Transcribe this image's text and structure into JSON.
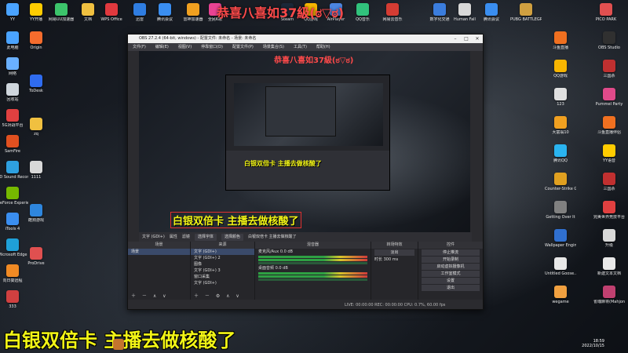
{
  "banner": {
    "top_text": "恭喜八喜如37級(ಠ▽ಠ)"
  },
  "caption": {
    "main": "白银双倍卡 主播去做核酸了"
  },
  "clock": {
    "time": "18:59",
    "date": "2022/10/15"
  },
  "desktop_icons_top": [
    {
      "label": "YY",
      "color": "#4aa3ff"
    },
    {
      "label": "YY开播",
      "color": "#ffcc00"
    },
    {
      "label": "网易UU加速器",
      "color": "#3cc46b"
    },
    {
      "label": "文档",
      "color": "#f0c040"
    },
    {
      "label": "WPS Office",
      "color": "#e0393e"
    },
    {
      "label": "迅雷",
      "color": "#2f7de1"
    },
    {
      "label": "腾讯会议",
      "color": "#3a8ef0"
    },
    {
      "label": "雷神加速器",
      "color": "#f0a020"
    },
    {
      "label": "全民K歌",
      "color": "#e84393"
    },
    {
      "label": "Steam",
      "color": "#1b2838"
    },
    {
      "label": "QQ游戏",
      "color": "#f7b500"
    },
    {
      "label": "AirPlayer",
      "color": "#4c86e0"
    },
    {
      "label": "QQ音乐",
      "color": "#31c27c"
    },
    {
      "label": "网易云音乐",
      "color": "#d43c33"
    },
    {
      "label": "数字化交通",
      "color": "#3b7ddd"
    },
    {
      "label": "Human Fall",
      "color": "#d8d8d8"
    },
    {
      "label": "腾讯会议",
      "color": "#3a8ef0"
    },
    {
      "label": "PUBG BATTLEGR...",
      "color": "#d0a040"
    },
    {
      "label": "PICO PARK",
      "color": "#e05050"
    }
  ],
  "desktop_icons_left": [
    {
      "label": "此电脑",
      "color": "#4aa3ff"
    },
    {
      "label": "网络",
      "color": "#6ab0ff"
    },
    {
      "label": "回收站",
      "color": "#cfd6dd"
    },
    {
      "label": "5G对战平台",
      "color": "#e04040"
    },
    {
      "label": "SamFire",
      "color": "#e05020"
    },
    {
      "label": "AD Sound Recorder",
      "color": "#2ea0e0"
    },
    {
      "label": "GeForce Experience",
      "color": "#76b900"
    },
    {
      "label": "iTools 4",
      "color": "#3a8ef0"
    },
    {
      "label": "Microsoft Edge",
      "color": "#1fa0d8"
    },
    {
      "label": "向日葵远程",
      "color": "#f08a24"
    },
    {
      "label": "333",
      "color": "#d04040"
    }
  ],
  "desktop_icons_left2": [
    {
      "label": "Origin",
      "color": "#f56c2d"
    },
    {
      "label": "ToDesk",
      "color": "#2f6cf0"
    },
    {
      "label": "zq",
      "color": "#f0c040"
    },
    {
      "label": "1111",
      "color": "#d8d8d8"
    },
    {
      "label": "酷狗游戏",
      "color": "#2e86de"
    },
    {
      "label": "ProDrive",
      "color": "#e05050"
    }
  ],
  "desktop_icons_right": [
    {
      "label": "斗鱼直播",
      "color": "#f07020"
    },
    {
      "label": "QQ游戏",
      "color": "#f7b500"
    },
    {
      "label": "123",
      "color": "#e0e0e0"
    },
    {
      "label": "大富翁10",
      "color": "#f0a020"
    },
    {
      "label": "腾讯QQ",
      "color": "#2ab4f0"
    },
    {
      "label": "Counter-Strike Global Off...",
      "color": "#e0a020"
    },
    {
      "label": "Getting Over It",
      "color": "#808080"
    },
    {
      "label": "Wallpaper Engine",
      "color": "#3070d0"
    },
    {
      "label": "Untitled Goose...",
      "color": "#e8e8e8"
    },
    {
      "label": "wegame",
      "color": "#f0a040"
    }
  ],
  "desktop_icons_right2": [
    {
      "label": "OBS Studio",
      "color": "#303030"
    },
    {
      "label": "三国杀",
      "color": "#c03030"
    },
    {
      "label": "Pummel Party",
      "color": "#e04a8a"
    },
    {
      "label": "斗鱼直播伴侣",
      "color": "#f07020"
    },
    {
      "label": "YY语音",
      "color": "#ffcc00"
    },
    {
      "label": "三国杀",
      "color": "#c03030"
    },
    {
      "label": "完美世界竞技平台",
      "color": "#e04040"
    },
    {
      "label": "升级",
      "color": "#d8d8d8"
    },
    {
      "label": "新建文本文档",
      "color": "#e8e8e8"
    },
    {
      "label": "雀魂麻将(Mahjong...",
      "color": "#c04070"
    }
  ],
  "obs": {
    "title": "OBS 27.2.4 (64-bit, windows) - 配置文件: 未命名 - 场景: 未命名",
    "menu": [
      "文件(F)",
      "编辑(E)",
      "视图(V)",
      "停靠窗口(D)",
      "配置文件(P)",
      "场景集合(S)",
      "工具(T)",
      "帮助(H)"
    ],
    "source_bar": {
      "selected": "文字 (GDI+)",
      "props": "属性",
      "filters": "滤镜",
      "font": "选择字体",
      "color": "选择颜色",
      "text": "白银双倍卡 主播去做核酸了"
    },
    "scenes": {
      "title": "场景",
      "items": [
        "场景"
      ]
    },
    "sources": {
      "title": "来源",
      "items": [
        "文字 (GDI+)",
        "文字 (GDI+) 2",
        "图像",
        "文字 (GDI+) 3",
        "窗口采集",
        "文字 (GDI+)",
        "显示器采集"
      ]
    },
    "mixer": {
      "title": "混音器",
      "channels": [
        {
          "name": "麦克风/Aux",
          "db": "0.0 dB"
        },
        {
          "name": "桌面音频",
          "db": "0.0 dB"
        }
      ]
    },
    "transitions": {
      "title": "转场特效",
      "type": "淡出",
      "duration_label": "时长",
      "duration": "300 ms"
    },
    "controls": {
      "title": "控件",
      "buttons": [
        "停止推流",
        "开始录制",
        "启动虚拟摄像机",
        "工作室模式",
        "设置",
        "退出"
      ]
    },
    "status": "LIVE: 00:00:00   REC: 00:00:00   CPU: 0.7%, 60.00 fps"
  },
  "inner": {
    "banner": "恭喜八喜如37級(ಠ▽ಠ)",
    "caption": "白银双倍卡 主播去做核酸了",
    "preview_caption": "白银双倍卡 主播去做核酸了"
  }
}
